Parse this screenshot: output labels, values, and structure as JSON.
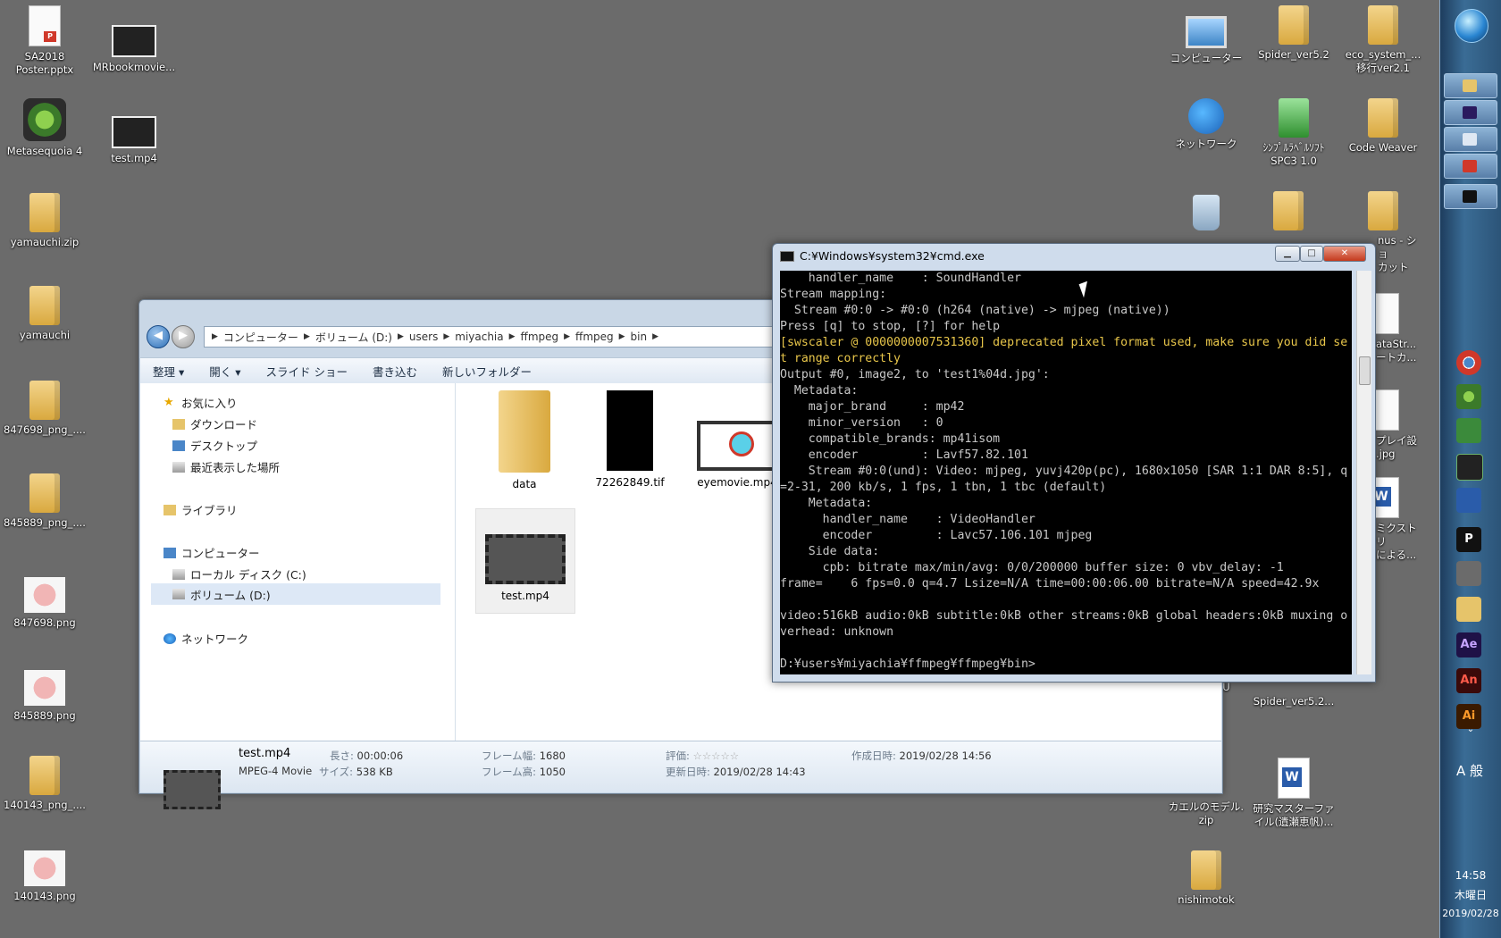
{
  "desktop": {
    "left_icons": [
      {
        "label": "SA2018\nPoster.pptx",
        "icon": "pptx-icon"
      },
      {
        "label": "MRbookmovie...",
        "icon": "video-icon"
      },
      {
        "label": "Metasequoia 4",
        "icon": "app-icon"
      },
      {
        "label": "test.mp4",
        "icon": "video-icon"
      },
      {
        "label": "yamauchi.zip",
        "icon": "zip-folder-icon"
      },
      {
        "label": "yamauchi",
        "icon": "folder-icon"
      },
      {
        "label": "847698_png_....",
        "icon": "zip-folder-icon"
      },
      {
        "label": "845889_png_....",
        "icon": "zip-folder-icon"
      },
      {
        "label": "847698.png",
        "icon": "image-icon"
      },
      {
        "label": "845889.png",
        "icon": "image-icon"
      },
      {
        "label": "140143_png_....",
        "icon": "zip-folder-icon"
      },
      {
        "label": "140143.png",
        "icon": "image-icon"
      }
    ],
    "right_icons": [
      {
        "label": "コンピューター",
        "icon": "computer-icon"
      },
      {
        "label": "Spider_ver5.2",
        "icon": "folder-icon"
      },
      {
        "label": "eco_system_...\n移行ver2.1",
        "icon": "folder-icon"
      },
      {
        "label": "ネットワーク",
        "icon": "network-icon"
      },
      {
        "label": "ｼﾝﾌﾟﾙﾗﾍﾞﾙｿﾌﾄ\nSPC3 1.0",
        "icon": "app-icon"
      },
      {
        "label": "Code Weaver",
        "icon": "folder-icon"
      },
      {
        "label": "",
        "icon": "recycle-bin-icon"
      },
      {
        "label": "",
        "icon": "folder-icon"
      },
      {
        "label": "nus - ショ\nカット",
        "icon": "folder-icon"
      },
      {
        "label": "ataStr...\nートカ...",
        "icon": "document-icon"
      },
      {
        "label": "プレイ設\n.jpg",
        "icon": "document-icon"
      },
      {
        "label": "ミクストリ\nによる...",
        "icon": "word-icon"
      },
      {
        "label": "GU",
        "icon": "folder-icon"
      },
      {
        "label": "Spider_ver5.2...",
        "icon": "zip-folder-icon"
      },
      {
        "label": "カエルのモデル.\nzip",
        "icon": "zip-folder-icon"
      },
      {
        "label": "研究マスターファ\nイル(遺瀬恵帆)...",
        "icon": "word-icon"
      },
      {
        "label": "nishimotok",
        "icon": "folder-icon"
      }
    ]
  },
  "explorer": {
    "breadcrumbs": [
      "コンピューター",
      "ボリューム (D:)",
      "users",
      "miyachia",
      "ffmpeg",
      "ffmpeg",
      "bin"
    ],
    "toolbar": [
      "整理 ▾",
      "開く ▾",
      "スライド ショー",
      "書き込む",
      "新しいフォルダー"
    ],
    "nav": {
      "favorites": "お気に入り",
      "downloads": "ダウンロード",
      "desktop": "デスクトップ",
      "recent": "最近表示した場所",
      "libraries": "ライブラリ",
      "computer": "コンピューター",
      "local_disk": "ローカル ディスク (C:)",
      "volume_d": "ボリューム (D:)",
      "network": "ネットワーク"
    },
    "files": [
      {
        "name": "data",
        "type": "folder"
      },
      {
        "name": "72262849.tif",
        "type": "image"
      },
      {
        "name": "eyemovie.mp4",
        "type": "video"
      },
      {
        "name": "test.mp4",
        "type": "video",
        "selected": true
      }
    ],
    "details": {
      "name": "test.mp4",
      "type": "MPEG-4 Movie",
      "length_label": "長さ:",
      "length": "00:00:06",
      "size_label": "サイズ:",
      "size": "538 KB",
      "frame_width_label": "フレーム幅:",
      "frame_width": "1680",
      "frame_height_label": "フレーム高:",
      "frame_height": "1050",
      "rating_label": "評価:",
      "rating": "☆☆☆☆☆",
      "modified_label": "更新日時:",
      "modified": "2019/02/28 14:43",
      "created_label": "作成日時:",
      "created": "2019/02/28 14:56"
    }
  },
  "cmd": {
    "title": "C:¥Windows¥system32¥cmd.exe",
    "lines": [
      {
        "text": "    handler_name    : SoundHandler",
        "warn": false
      },
      {
        "text": "Stream mapping:",
        "warn": false
      },
      {
        "text": "  Stream #0:0 -> #0:0 (h264 (native) -> mjpeg (native))",
        "warn": false
      },
      {
        "text": "Press [q] to stop, [?] for help",
        "warn": false
      },
      {
        "text": "[swscaler @ 0000000007531360] deprecated pixel format used, make sure you did se",
        "warn": true
      },
      {
        "text": "t range correctly",
        "warn": true
      },
      {
        "text": "Output #0, image2, to 'test1%04d.jpg':",
        "warn": false
      },
      {
        "text": "  Metadata:",
        "warn": false
      },
      {
        "text": "    major_brand     : mp42",
        "warn": false
      },
      {
        "text": "    minor_version   : 0",
        "warn": false
      },
      {
        "text": "    compatible_brands: mp41isom",
        "warn": false
      },
      {
        "text": "    encoder         : Lavf57.82.101",
        "warn": false
      },
      {
        "text": "    Stream #0:0(und): Video: mjpeg, yuvj420p(pc), 1680x1050 [SAR 1:1 DAR 8:5], q",
        "warn": false
      },
      {
        "text": "=2-31, 200 kb/s, 1 fps, 1 tbn, 1 tbc (default)",
        "warn": false
      },
      {
        "text": "    Metadata:",
        "warn": false
      },
      {
        "text": "      handler_name    : VideoHandler",
        "warn": false
      },
      {
        "text": "      encoder         : Lavc57.106.101 mjpeg",
        "warn": false
      },
      {
        "text": "    Side data:",
        "warn": false
      },
      {
        "text": "      cpb: bitrate max/min/avg: 0/0/200000 buffer size: 0 vbv_delay: -1",
        "warn": false
      },
      {
        "text": "frame=    6 fps=0.0 q=4.7 Lsize=N/A time=00:00:06.00 bitrate=N/A speed=42.9x",
        "warn": false
      },
      {
        "text": "",
        "warn": false
      },
      {
        "text": "video:516kB audio:0kB subtitle:0kB other streams:0kB global headers:0kB muxing o",
        "warn": false
      },
      {
        "text": "verhead: unknown",
        "warn": false
      },
      {
        "text": "",
        "warn": false
      },
      {
        "text": "D:¥users¥miyachia¥ffmpeg¥ffmpeg¥bin>",
        "warn": false
      }
    ]
  },
  "taskbar": {
    "ime": "A 般",
    "time": "14:58",
    "weekday": "木曜日",
    "date": "2019/02/28"
  }
}
